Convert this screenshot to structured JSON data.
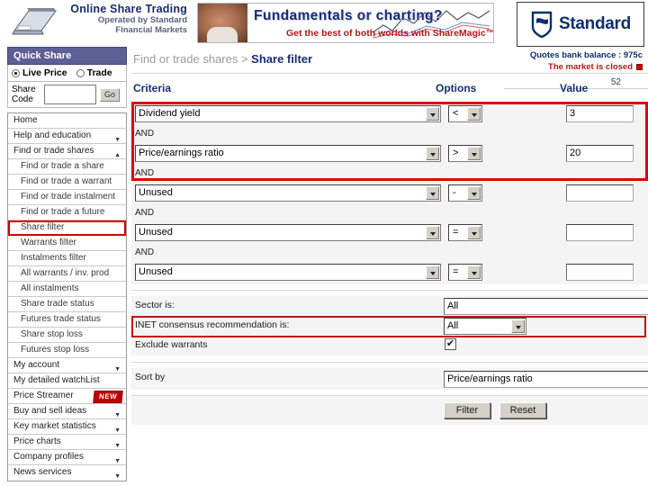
{
  "brand": {
    "logo_line1": "Online Share Trading",
    "logo_line2": "Operated by Standard",
    "logo_line3": "Financial Markets",
    "bank_name": "Standard",
    "accent_blue": "#17306f",
    "accent_red": "#e00000"
  },
  "banner": {
    "headline": "Fundamentals or charting?",
    "subline": "Get the best of both worlds with ShareMagic™"
  },
  "status": {
    "quotes_balance": "Quotes bank balance : 975c",
    "market_state": "The market is closed",
    "counter": "52"
  },
  "quick_share": {
    "title": "Quick Share",
    "option_live": "Live Price",
    "option_trade": "Trade",
    "code_label_line1": "Share",
    "code_label_line2": "Code",
    "code_value": "",
    "go_label": "Go"
  },
  "sidebar": {
    "items": [
      {
        "label": "Home",
        "sub": false,
        "arrow": "",
        "highlight": false,
        "badge": ""
      },
      {
        "label": "Help and education",
        "sub": false,
        "arrow": "▼",
        "highlight": false,
        "badge": ""
      },
      {
        "label": "Find or trade shares",
        "sub": false,
        "arrow": "▲",
        "highlight": false,
        "badge": ""
      },
      {
        "label": "Find or trade a share",
        "sub": true,
        "arrow": "",
        "highlight": false,
        "badge": ""
      },
      {
        "label": "Find or trade a warrant",
        "sub": true,
        "arrow": "",
        "highlight": false,
        "badge": ""
      },
      {
        "label": "Find or trade instalment",
        "sub": true,
        "arrow": "",
        "highlight": false,
        "badge": ""
      },
      {
        "label": "Find or trade a future",
        "sub": true,
        "arrow": "",
        "highlight": false,
        "badge": ""
      },
      {
        "label": "Share filter",
        "sub": true,
        "arrow": "",
        "highlight": true,
        "badge": ""
      },
      {
        "label": "Warrants filter",
        "sub": true,
        "arrow": "",
        "highlight": false,
        "badge": ""
      },
      {
        "label": "Instalments filter",
        "sub": true,
        "arrow": "",
        "highlight": false,
        "badge": ""
      },
      {
        "label": "All warrants / inv. prod",
        "sub": true,
        "arrow": "",
        "highlight": false,
        "badge": ""
      },
      {
        "label": "All instalments",
        "sub": true,
        "arrow": "",
        "highlight": false,
        "badge": ""
      },
      {
        "label": "Share trade status",
        "sub": true,
        "arrow": "",
        "highlight": false,
        "badge": ""
      },
      {
        "label": "Futures trade status",
        "sub": true,
        "arrow": "",
        "highlight": false,
        "badge": ""
      },
      {
        "label": "Share stop loss",
        "sub": true,
        "arrow": "",
        "highlight": false,
        "badge": ""
      },
      {
        "label": "Futures stop loss",
        "sub": true,
        "arrow": "",
        "highlight": false,
        "badge": ""
      },
      {
        "label": "My account",
        "sub": false,
        "arrow": "▼",
        "highlight": false,
        "badge": ""
      },
      {
        "label": "My detailed watchList",
        "sub": false,
        "arrow": "",
        "highlight": false,
        "badge": ""
      },
      {
        "label": "Price Streamer",
        "sub": false,
        "arrow": "",
        "highlight": false,
        "badge": "NEW"
      },
      {
        "label": "Buy and sell ideas",
        "sub": false,
        "arrow": "▼",
        "highlight": false,
        "badge": ""
      },
      {
        "label": "Key market statistics",
        "sub": false,
        "arrow": "▼",
        "highlight": false,
        "badge": ""
      },
      {
        "label": "Price charts",
        "sub": false,
        "arrow": "▼",
        "highlight": false,
        "badge": ""
      },
      {
        "label": "Company profiles",
        "sub": false,
        "arrow": "▼",
        "highlight": false,
        "badge": ""
      },
      {
        "label": "News services",
        "sub": false,
        "arrow": "▼",
        "highlight": false,
        "badge": ""
      }
    ]
  },
  "breadcrumb": {
    "parent": "Find or trade shares >",
    "current": "Share filter"
  },
  "columns": {
    "criteria": "Criteria",
    "options": "Options",
    "value": "Value"
  },
  "conjunction": "AND",
  "criteria_rows": [
    {
      "field": "Dividend yield",
      "operator": "<",
      "value": "3"
    },
    {
      "field": "Price/earnings ratio",
      "operator": ">",
      "value": "20"
    },
    {
      "field": "Unused",
      "operator": "-",
      "value": ""
    },
    {
      "field": "Unused",
      "operator": "=",
      "value": ""
    },
    {
      "field": "Unused",
      "operator": "=",
      "value": ""
    }
  ],
  "filters": {
    "sector_label": "Sector is:",
    "sector_value": "All",
    "inet_label": "INET consensus recommendation is:",
    "inet_value": "All",
    "exclude_label": "Exclude warrants",
    "exclude_checked": "✔",
    "sort_label": "Sort by",
    "sort_value": "Price/earnings ratio"
  },
  "buttons": {
    "filter": "Filter",
    "reset": "Reset"
  }
}
